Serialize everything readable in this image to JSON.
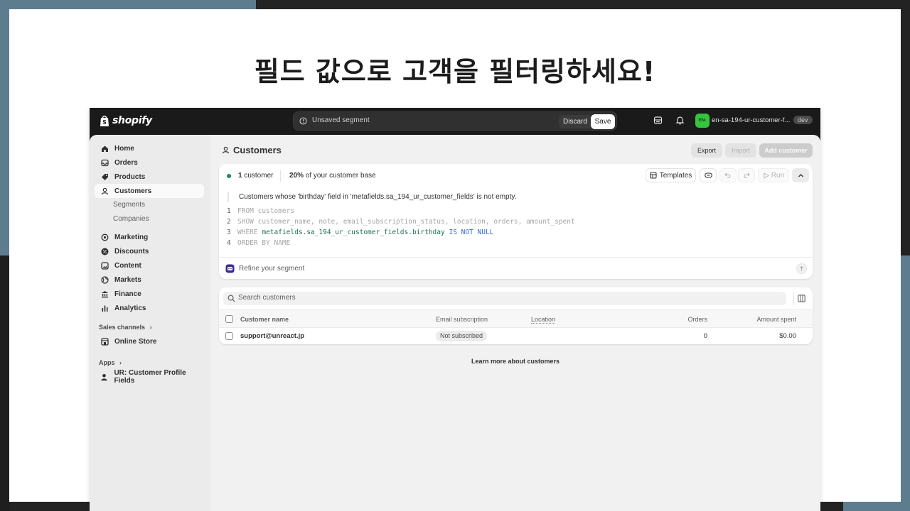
{
  "headline": "필드 값으로 고객을 필터링하세요!",
  "topbar": {
    "logo_text": "shopify",
    "segment_label": "Unsaved segment",
    "discard": "Discard",
    "save": "Save",
    "store_badge": "EN-",
    "store_name": "en-sa-194-ur-customer-f...",
    "env": "dev"
  },
  "sidebar": {
    "items": [
      {
        "label": "Home",
        "icon": "home-icon"
      },
      {
        "label": "Orders",
        "icon": "inbox-icon"
      },
      {
        "label": "Products",
        "icon": "tag-icon"
      },
      {
        "label": "Customers",
        "icon": "person-icon"
      }
    ],
    "sub_items": [
      "Segments",
      "Companies"
    ],
    "items2": [
      {
        "label": "Marketing",
        "icon": "target-icon"
      },
      {
        "label": "Discounts",
        "icon": "discount-icon"
      },
      {
        "label": "Content",
        "icon": "content-icon"
      },
      {
        "label": "Markets",
        "icon": "globe-icon"
      },
      {
        "label": "Finance",
        "icon": "bank-icon"
      },
      {
        "label": "Analytics",
        "icon": "chart-icon"
      }
    ],
    "sales_channels": "Sales channels",
    "online_store": "Online Store",
    "apps": "Apps",
    "app_item": "UR: Customer Profile Fields"
  },
  "page": {
    "title": "Customers",
    "export": "Export",
    "import": "Import",
    "add_customer": "Add customer"
  },
  "segment": {
    "count_num": "1",
    "count_word": " customer",
    "pct_num": "20%",
    "pct_rest": " of your customer base",
    "templates": "Templates",
    "run": "Run",
    "description": "Customers whose 'birthday' field in 'metafields.sa_194_ur_customer_fields' is not empty.",
    "code": {
      "l1": "FROM customers",
      "l2": "SHOW customer_name, note, email_subscription_status, location, orders, amount_spent",
      "l3_kw": "WHERE",
      "l3_field": "metafields.sa_194_ur_customer_fields.birthday",
      "l3_cond": "IS NOT NULL",
      "l4": "ORDER BY NAME"
    },
    "refine_placeholder": "Refine your segment"
  },
  "table": {
    "search_placeholder": "Search customers",
    "headers": {
      "name": "Customer name",
      "email": "Email subscription",
      "location": "Location",
      "orders": "Orders",
      "amount": "Amount spent"
    },
    "rows": [
      {
        "name": "support@unreact.jp",
        "email": "Not subscribed",
        "location": "",
        "orders": "0",
        "amount": "$0.00"
      }
    ]
  },
  "learn_more": "Learn more about customers",
  "colors": {
    "accent_green": "#29845a",
    "store_badge": "#36c43f",
    "keyword_blue": "#2c6ecb"
  }
}
